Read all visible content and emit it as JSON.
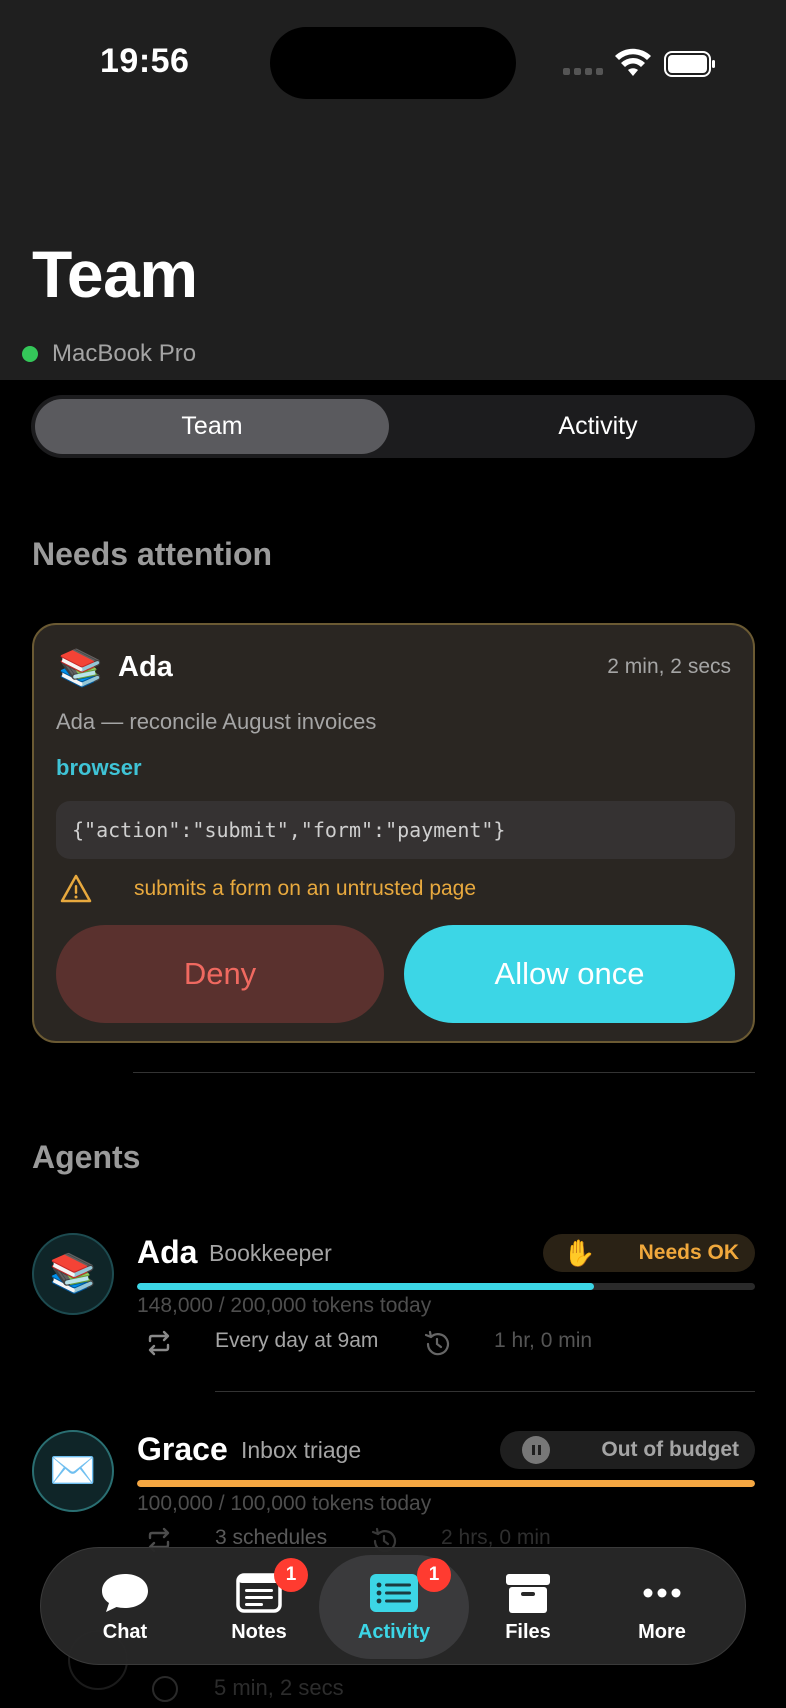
{
  "status_bar": {
    "time": "19:56"
  },
  "header": {
    "title": "Team",
    "device": "MacBook Pro"
  },
  "segment": {
    "options": [
      "Team",
      "Activity"
    ],
    "selected": "Team"
  },
  "attention": {
    "section_title": "Needs attention",
    "card": {
      "emoji": "📚",
      "name": "Ada",
      "elapsed": "2 min, 2 secs",
      "task": "Ada — reconcile August invoices",
      "tool": "browser",
      "payload": "{\"action\":\"submit\",\"form\":\"payment\"}",
      "warning": "submits a form on an untrusted page",
      "deny_label": "Deny",
      "allow_label": "Allow once"
    }
  },
  "agents": {
    "section_title": "Agents",
    "items": [
      {
        "emoji": "📚",
        "name": "Ada",
        "role": "Bookkeeper",
        "badge": "Needs OK",
        "badge_icon": "raised-hand-icon",
        "usage_fraction": 0.74,
        "usage_color": "#3cd6e6",
        "tokens": "148,000 / 200,000 tokens today",
        "schedule": "Every day at 9am",
        "last_run": "1 hr, 0 min"
      },
      {
        "emoji": "✉️",
        "name": "Grace",
        "role": "Inbox triage",
        "badge": "Out of budget",
        "badge_icon": "pause-icon",
        "usage_fraction": 1.0,
        "usage_color": "#f5a742",
        "tokens": "100,000 / 100,000 tokens today",
        "schedule": "3 schedules",
        "last_run": "2 hrs, 0 min"
      }
    ],
    "partial_next_last_run": "5 min, 2 secs"
  },
  "tabbar": {
    "items": [
      {
        "label": "Chat",
        "icon": "chat-bubble-icon"
      },
      {
        "label": "Notes",
        "icon": "notes-icon",
        "badge": "1"
      },
      {
        "label": "Activity",
        "icon": "activity-list-icon",
        "badge": "1",
        "active": true
      },
      {
        "label": "Files",
        "icon": "archive-box-icon"
      },
      {
        "label": "More",
        "icon": "more-dots-icon"
      }
    ]
  },
  "colors": {
    "accent": "#3cd6e6",
    "warning": "#e8a93e",
    "deny": "#f06960",
    "online": "#34c759"
  }
}
